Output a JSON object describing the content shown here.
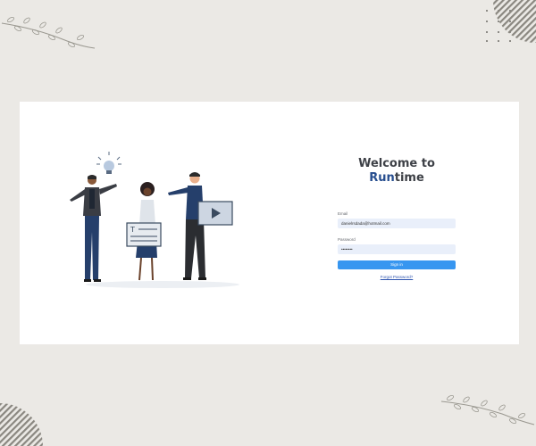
{
  "welcome": {
    "line1": "Welcome to",
    "brand_accent": "Run",
    "brand_rest": "time"
  },
  "form": {
    "email_label": "Email",
    "email_value": "danielrsdada@hotmail.com",
    "password_label": "Password",
    "password_value": "••••••••",
    "signin_label": "Sign in",
    "forgot_label": "Forgot Password?"
  },
  "colors": {
    "page_bg": "#ebe9e5",
    "brand_accent": "#274e8f",
    "button": "#3796f0",
    "field_bg": "#e9effa"
  }
}
